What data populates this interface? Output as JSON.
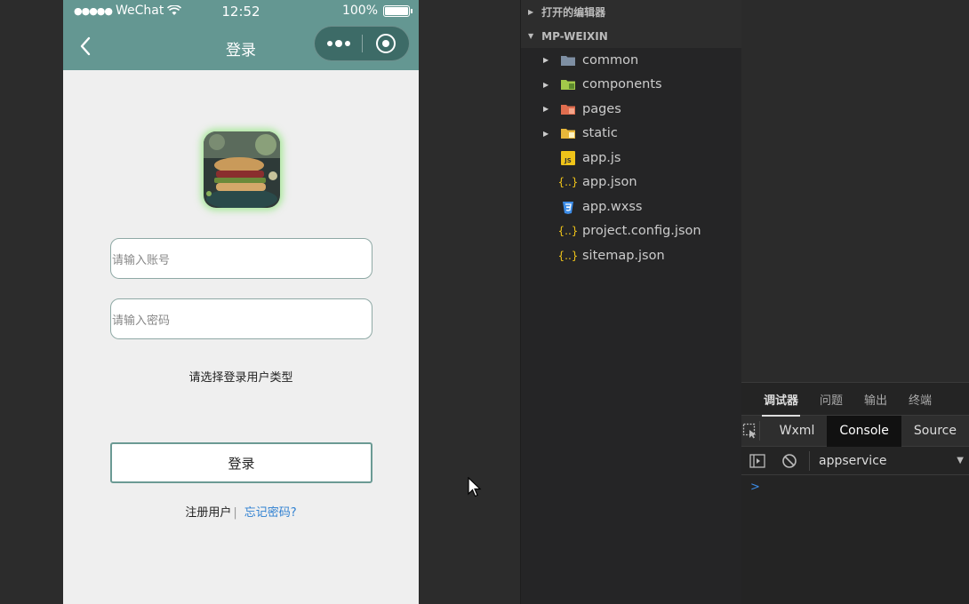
{
  "phone": {
    "status": {
      "carrier": "WeChat",
      "time": "12:52",
      "battery": "100%"
    },
    "nav": {
      "title": "登录"
    },
    "form": {
      "account_placeholder": "请输入账号",
      "password_placeholder": "请输入密码",
      "user_type_prompt": "请选择登录用户类型",
      "login_label": "登录",
      "register_label": "注册用户",
      "separator": "|",
      "forgot_label": "忘记密码?"
    }
  },
  "explorer": {
    "open_editors": "打开的编辑器",
    "project": "MP-WEIXIN",
    "items": [
      {
        "label": "common",
        "icon": "folder-icon",
        "color": "#7e8fa3"
      },
      {
        "label": "components",
        "icon": "components-folder-icon",
        "color": "#a3c94a"
      },
      {
        "label": "pages",
        "icon": "pages-folder-icon",
        "color": "#e06d4f"
      },
      {
        "label": "static",
        "icon": "static-folder-icon",
        "color": "#e8b73a"
      },
      {
        "label": "app.js",
        "icon": "js-file-icon",
        "color": "#f0c419"
      },
      {
        "label": "app.json",
        "icon": "json-file-icon",
        "color": "#f0c419"
      },
      {
        "label": "app.wxss",
        "icon": "css-file-icon",
        "color": "#3c8ce7"
      },
      {
        "label": "project.config.json",
        "icon": "json-file-icon",
        "color": "#f0c419"
      },
      {
        "label": "sitemap.json",
        "icon": "json-file-icon",
        "color": "#f0c419"
      }
    ]
  },
  "devtools": {
    "tabs": [
      "调试器",
      "问题",
      "输出",
      "终端"
    ],
    "subtabs": [
      "Wxml",
      "Console",
      "Source"
    ],
    "context": "appservice",
    "prompt": ">"
  }
}
